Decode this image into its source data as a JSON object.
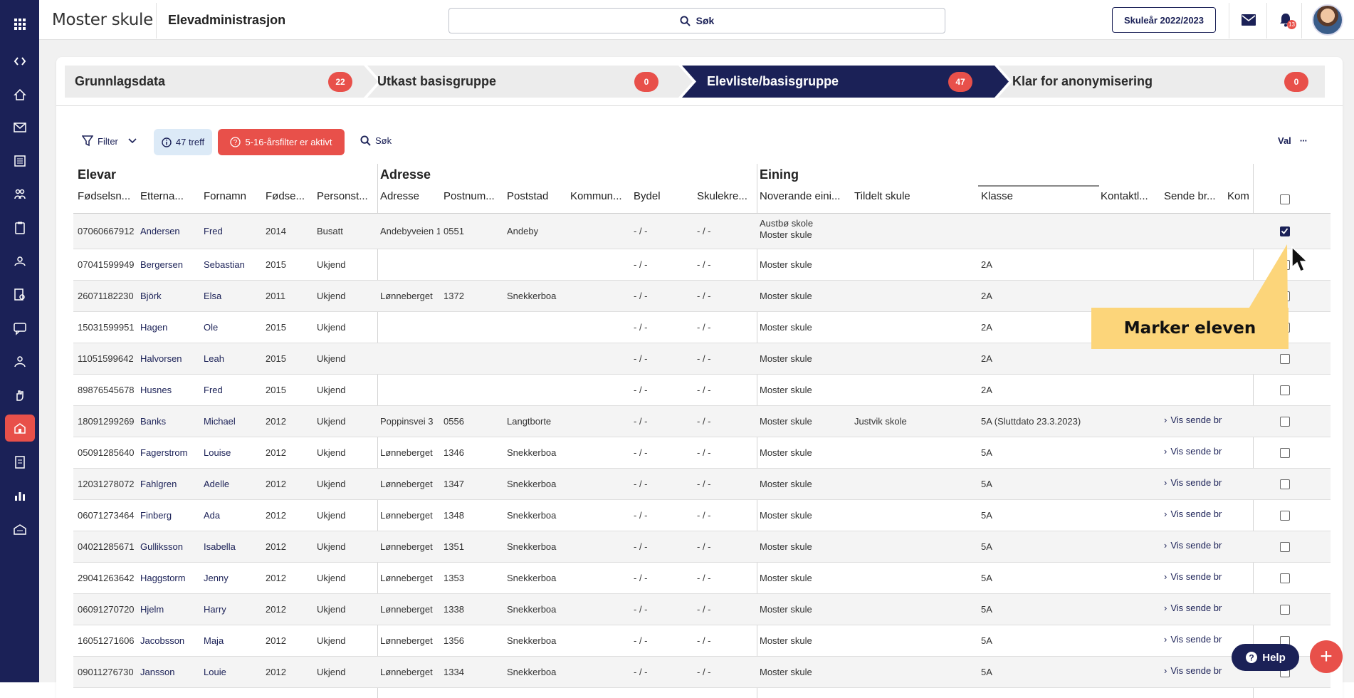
{
  "header": {
    "brand": "Moster skule",
    "app_title": "Elevadministrasjon",
    "search_label": "Søk",
    "school_year": "Skuleår 2022/2023",
    "notification_count": "13"
  },
  "steps": [
    {
      "label": "Grunnlagsdata",
      "count": "22"
    },
    {
      "label": "Utkast basisgruppe",
      "count": "0"
    },
    {
      "label": "Elevliste/basisgruppe",
      "count": "47"
    },
    {
      "label": "Klar for anonymisering",
      "count": "0"
    }
  ],
  "toolbar": {
    "filter_label": "Filter",
    "hits_label": "47 treff",
    "age_filter_label": "5-16-årsfilter er aktivt",
    "search_label": "Søk",
    "val_label": "Val",
    "more_label": "···"
  },
  "groups": {
    "elevar": "Elevar",
    "adresse": "Adresse",
    "eining": "Eining"
  },
  "columns": [
    "Fødselsn...",
    "Etterna...",
    "Fornamn",
    "Fødse...",
    "Personst...",
    "Adresse",
    "Postnum...",
    "Poststad",
    "Kommun...",
    "Bydel",
    "Skulekre...",
    "Noverande eini...",
    "Tildelt skule",
    "Klasse",
    "Kontaktl...",
    "Sende br...",
    "Kom"
  ],
  "rows": [
    {
      "fnr": "07060667912",
      "last": "Andersen",
      "first": "Fred",
      "year": "2014",
      "status": "Busatt",
      "addr": "Andebyveien 1",
      "zip": "0551",
      "city": "Andeby",
      "bydel": "- / -",
      "krets": "- / -",
      "unit": "Austbø skole",
      "unit2": "Moster skule",
      "assigned": "",
      "class": "",
      "send": "",
      "checked": true
    },
    {
      "fnr": "07041599949",
      "last": "Bergersen",
      "first": "Sebastian",
      "year": "2015",
      "status": "Ukjend",
      "addr": "",
      "zip": "",
      "city": "",
      "bydel": "- / -",
      "krets": "- / -",
      "unit": "Moster skule",
      "unit2": "",
      "assigned": "",
      "class": "2A",
      "send": "",
      "checked": false
    },
    {
      "fnr": "26071182230",
      "last": "Björk",
      "first": "Elsa",
      "year": "2011",
      "status": "Ukjend",
      "addr": "Lønneberget",
      "zip": "1372",
      "city": "Snekkerboa",
      "bydel": "- / -",
      "krets": "- / -",
      "unit": "Moster skule",
      "unit2": "",
      "assigned": "",
      "class": "2A",
      "send": "",
      "checked": false
    },
    {
      "fnr": "15031599951",
      "last": "Hagen",
      "first": "Ole",
      "year": "2015",
      "status": "Ukjend",
      "addr": "",
      "zip": "",
      "city": "",
      "bydel": "- / -",
      "krets": "- / -",
      "unit": "Moster skule",
      "unit2": "",
      "assigned": "",
      "class": "2A",
      "send": "",
      "checked": false
    },
    {
      "fnr": "11051599642",
      "last": "Halvorsen",
      "first": "Leah",
      "year": "2015",
      "status": "Ukjend",
      "addr": "",
      "zip": "",
      "city": "",
      "bydel": "- / -",
      "krets": "- / -",
      "unit": "Moster skule",
      "unit2": "",
      "assigned": "",
      "class": "2A",
      "send": "",
      "checked": false
    },
    {
      "fnr": "89876545678",
      "last": "Husnes",
      "first": "Fred",
      "year": "2015",
      "status": "Ukjend",
      "addr": "",
      "zip": "",
      "city": "",
      "bydel": "- / -",
      "krets": "- / -",
      "unit": "Moster skule",
      "unit2": "",
      "assigned": "",
      "class": "2A",
      "send": "",
      "checked": false
    },
    {
      "fnr": "18091299269",
      "last": "Banks",
      "first": "Michael",
      "year": "2012",
      "status": "Ukjend",
      "addr": "Poppinsvei 3",
      "zip": "0556",
      "city": "Langtborte",
      "bydel": "- / -",
      "krets": "- / -",
      "unit": "Moster skule",
      "unit2": "",
      "assigned": "Justvik skole",
      "class": "5A (Sluttdato 23.3.2023)",
      "send": "Vis sende br",
      "checked": false
    },
    {
      "fnr": "05091285640",
      "last": "Fagerstrom",
      "first": "Louise",
      "year": "2012",
      "status": "Ukjend",
      "addr": "Lønneberget",
      "zip": "1346",
      "city": "Snekkerboa",
      "bydel": "- / -",
      "krets": "- / -",
      "unit": "Moster skule",
      "unit2": "",
      "assigned": "",
      "class": "5A",
      "send": "Vis sende br",
      "checked": false
    },
    {
      "fnr": "12031278072",
      "last": "Fahlgren",
      "first": "Adelle",
      "year": "2012",
      "status": "Ukjend",
      "addr": "Lønneberget",
      "zip": "1347",
      "city": "Snekkerboa",
      "bydel": "- / -",
      "krets": "- / -",
      "unit": "Moster skule",
      "unit2": "",
      "assigned": "",
      "class": "5A",
      "send": "Vis sende br",
      "checked": false
    },
    {
      "fnr": "06071273464",
      "last": "Finberg",
      "first": "Ada",
      "year": "2012",
      "status": "Ukjend",
      "addr": "Lønneberget",
      "zip": "1348",
      "city": "Snekkerboa",
      "bydel": "- / -",
      "krets": "- / -",
      "unit": "Moster skule",
      "unit2": "",
      "assigned": "",
      "class": "5A",
      "send": "Vis sende br",
      "checked": false
    },
    {
      "fnr": "04021285671",
      "last": "Gulliksson",
      "first": "Isabella",
      "year": "2012",
      "status": "Ukjend",
      "addr": "Lønneberget",
      "zip": "1351",
      "city": "Snekkerboa",
      "bydel": "- / -",
      "krets": "- / -",
      "unit": "Moster skule",
      "unit2": "",
      "assigned": "",
      "class": "5A",
      "send": "Vis sende br",
      "checked": false
    },
    {
      "fnr": "29041263642",
      "last": "Haggstorm",
      "first": "Jenny",
      "year": "2012",
      "status": "Ukjend",
      "addr": "Lønneberget",
      "zip": "1353",
      "city": "Snekkerboa",
      "bydel": "- / -",
      "krets": "- / -",
      "unit": "Moster skule",
      "unit2": "",
      "assigned": "",
      "class": "5A",
      "send": "Vis sende br",
      "checked": false
    },
    {
      "fnr": "06091270720",
      "last": "Hjelm",
      "first": "Harry",
      "year": "2012",
      "status": "Ukjend",
      "addr": "Lønneberget",
      "zip": "1338",
      "city": "Snekkerboa",
      "bydel": "- / -",
      "krets": "- / -",
      "unit": "Moster skule",
      "unit2": "",
      "assigned": "",
      "class": "5A",
      "send": "Vis sende br",
      "checked": false
    },
    {
      "fnr": "16051271606",
      "last": "Jacobsson",
      "first": "Maja",
      "year": "2012",
      "status": "Ukjend",
      "addr": "Lønneberget",
      "zip": "1356",
      "city": "Snekkerboa",
      "bydel": "- / -",
      "krets": "- / -",
      "unit": "Moster skule",
      "unit2": "",
      "assigned": "",
      "class": "5A",
      "send": "Vis sende br",
      "checked": false
    },
    {
      "fnr": "09011276730",
      "last": "Jansson",
      "first": "Louie",
      "year": "2012",
      "status": "Ukjend",
      "addr": "Lønneberget",
      "zip": "1334",
      "city": "Snekkerboa",
      "bydel": "- / -",
      "krets": "- / -",
      "unit": "Moster skule",
      "unit2": "",
      "assigned": "",
      "class": "5A",
      "send": "Vis sende br",
      "checked": false
    }
  ],
  "tooltip": "Marker eleven",
  "help_label": "Help",
  "fab_label": "+",
  "colors": {
    "navy": "#1b2157",
    "accent": "#e8504a",
    "tooltip": "#fcd57a"
  }
}
